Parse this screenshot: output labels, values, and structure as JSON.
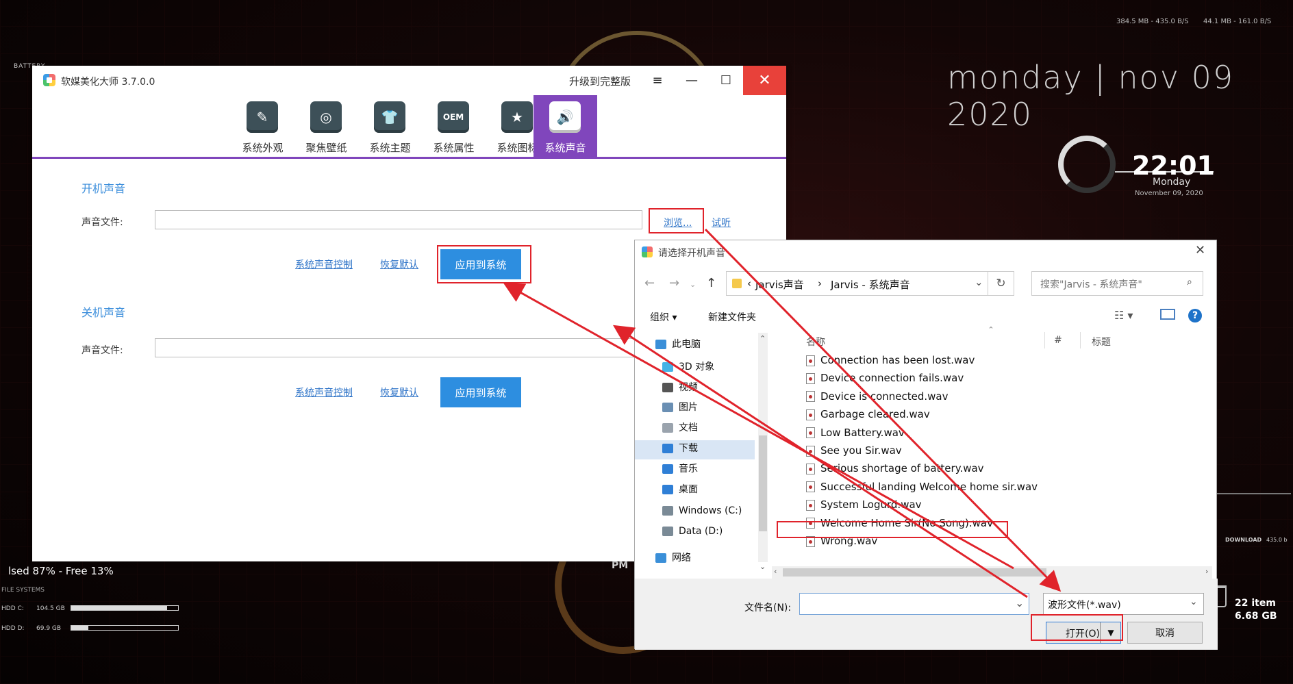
{
  "desktop": {
    "date_line": "monday  |  nov 09 2020",
    "net_up": "384.5 MB - 435.0 B/S",
    "net_down": "44.1 MB - 161.0 B/S",
    "clock_time": "22:01",
    "clock_day": "Monday",
    "clock_date": "November 09, 2020",
    "disk_summary": "lsed 87%  -  Free 13%",
    "filesystems_label": "FILE SYSTEMS",
    "hdd": [
      {
        "label": "HDD C:",
        "size": "104.5 GB",
        "used_fraction": 0.9
      },
      {
        "label": "HDD D:",
        "size": "69.9 GB",
        "used_fraction": 0.16
      }
    ],
    "battery_label": "BATTERY",
    "pm_label": "PM",
    "recycle_count": "22 item",
    "recycle_size": "6.68 GB",
    "download_label": "DOWNLOAD",
    "download_value": "435.0 b"
  },
  "app": {
    "title": "软媒美化大师 3.7.0.0",
    "upgrade": "升级到完整版",
    "controls": {
      "menu": "≡",
      "minimize": "—",
      "maximize": "☐",
      "close": "✕"
    },
    "tabs": [
      {
        "label": "系统外观",
        "icon": "brush-icon",
        "glyph": "✎"
      },
      {
        "label": "聚焦壁纸",
        "icon": "focus-icon",
        "glyph": "◎"
      },
      {
        "label": "系统主题",
        "icon": "tshirt-icon",
        "glyph": "👕"
      },
      {
        "label": "系统属性",
        "icon": "oem-icon",
        "glyph": "OEM"
      },
      {
        "label": "系统图标",
        "icon": "star-icon",
        "glyph": "★"
      },
      {
        "label": "系统声音",
        "icon": "speaker-icon",
        "glyph": "🔊"
      }
    ],
    "startup": {
      "title": "开机声音",
      "file_label": "声音文件:",
      "file_value": "",
      "browse": "浏览...",
      "preview": "试听",
      "sys_control": "系统声音控制",
      "restore": "恢复默认",
      "apply": "应用到系统"
    },
    "shutdown": {
      "title": "关机声音",
      "file_label": "声音文件:",
      "file_value": "",
      "sys_control": "系统声音控制",
      "restore": "恢复默认",
      "apply": "应用到系统"
    }
  },
  "dialog": {
    "title": "请选择开机声音",
    "breadcrumb": [
      "Jarvis声音",
      "Jarvis - 系统声音"
    ],
    "search_placeholder": "搜索\"Jarvis - 系统声音\"",
    "organize": "组织 ▾",
    "new_folder": "新建文件夹",
    "nav": [
      {
        "label": "此电脑",
        "icon": "computer-icon",
        "color": "#3a8fd8"
      },
      {
        "label": "3D 对象",
        "icon": "cube-icon",
        "color": "#45b3e6"
      },
      {
        "label": "视频",
        "icon": "video-icon",
        "color": "#555555"
      },
      {
        "label": "图片",
        "icon": "picture-icon",
        "color": "#6a8fb3"
      },
      {
        "label": "文档",
        "icon": "document-icon",
        "color": "#9aa3ad"
      },
      {
        "label": "下载",
        "icon": "download-icon",
        "color": "#2f7fd6"
      },
      {
        "label": "音乐",
        "icon": "music-icon",
        "color": "#2f7fd6"
      },
      {
        "label": "桌面",
        "icon": "desktop-icon",
        "color": "#2f7fd6"
      },
      {
        "label": "Windows (C:)",
        "icon": "drive-c-icon",
        "color": "#7a8a96"
      },
      {
        "label": "Data (D:)",
        "icon": "drive-d-icon",
        "color": "#7a8a96"
      },
      {
        "label": "网络",
        "icon": "network-icon",
        "color": "#3a8fd8"
      }
    ],
    "columns": {
      "name": "名称",
      "num": "#",
      "title": "标题"
    },
    "files": [
      "Connection has been lost.wav",
      "Device connection fails.wav",
      "Device is connected.wav",
      "Garbage cleared.wav",
      "Low Battery.wav",
      "See you Sir.wav",
      "Serious shortage of battery.wav",
      "Successful landing Welcome home sir.wav",
      "System Logurd.wav",
      "Welcome Home Sir(No Song).wav",
      "Wrong.wav"
    ],
    "filename_label": "文件名(N):",
    "filename_value": "",
    "filetype": "波形文件(*.wav)",
    "open": "打开(O)",
    "cancel": "取消"
  },
  "annotation_color": "#e0232b"
}
